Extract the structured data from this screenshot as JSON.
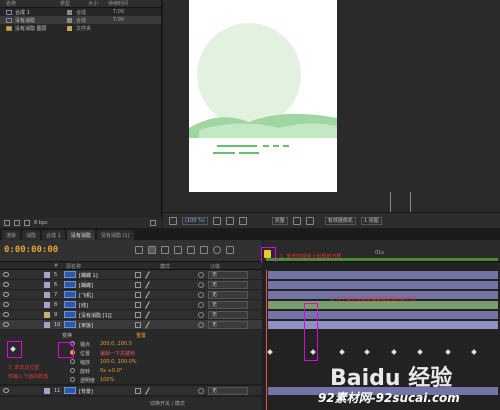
{
  "project": {
    "columns": [
      "名称",
      "类型",
      "大小",
      "持续时间"
    ],
    "items": [
      {
        "name": "合成 1",
        "type": "合成",
        "duration": "7:00"
      },
      {
        "name": "没有消隐",
        "type": "合成",
        "duration": "7:00",
        "selected": true
      },
      {
        "name": "没有消隐 图层",
        "type": "文件夹",
        "duration": ""
      }
    ],
    "footer_depth": "8 bpc"
  },
  "viewer": {
    "zoom": "(100 %)",
    "resolution": "完整",
    "camera": "有效摄像机",
    "views": "1 视图"
  },
  "tabs": [
    {
      "label": "渲染",
      "active": false
    },
    {
      "label": "消隐",
      "active": false
    },
    {
      "label": "合成 1",
      "active": false
    },
    {
      "label": "没有消隐",
      "active": true
    },
    {
      "label": "没有消隐 (1)",
      "active": false
    }
  ],
  "timeline": {
    "timecode": "0:00:00:00",
    "ruler_label": "01s",
    "header": [
      "#",
      "源名称",
      "模式",
      "父级"
    ],
    "layers": [
      {
        "num": "5",
        "name": "[蝴蝶 1]",
        "parent": "无"
      },
      {
        "num": "6",
        "name": "[蝴蝶]",
        "parent": "无"
      },
      {
        "num": "7",
        "name": "[飞机]",
        "parent": "无"
      },
      {
        "num": "8",
        "name": "[线]",
        "parent": "无"
      },
      {
        "num": "9",
        "name": "[没有消隐 [1]]",
        "parent": "无"
      },
      {
        "num": "10",
        "name": "[米饭]",
        "parent": "无"
      },
      {
        "num": "11",
        "name": "[背景]",
        "parent": "无"
      }
    ],
    "transform_label": "变换",
    "reset_label": "重置",
    "properties": [
      {
        "name": "锚点",
        "value": "200.0, 200.0"
      },
      {
        "name": "位置",
        "value": "",
        "note": "编辑一下关键帧"
      },
      {
        "name": "缩放",
        "value": "100.0, 100.0%"
      },
      {
        "name": "旋转",
        "value": "0x +0.0°"
      },
      {
        "name": "透明度",
        "value": "100%"
      }
    ],
    "footer_label": "切换开关 / 模式"
  },
  "annotations": {
    "work_area": "1. 单击时间线上出现的方框",
    "keyframe": "2. 在下面可以看到关键帧的表示的方向",
    "left_note_1": "3. 单击这位置",
    "left_note_2": "你输入下面的数值"
  },
  "watermark": {
    "baidu": "Baidu 经验",
    "site": "92素材网-92sucai.com"
  },
  "colors": {
    "timecode": "#e8a230",
    "layer_bar": "#7373a6",
    "highlight_box": "#e000e0",
    "annotation_text": "#e23838"
  }
}
